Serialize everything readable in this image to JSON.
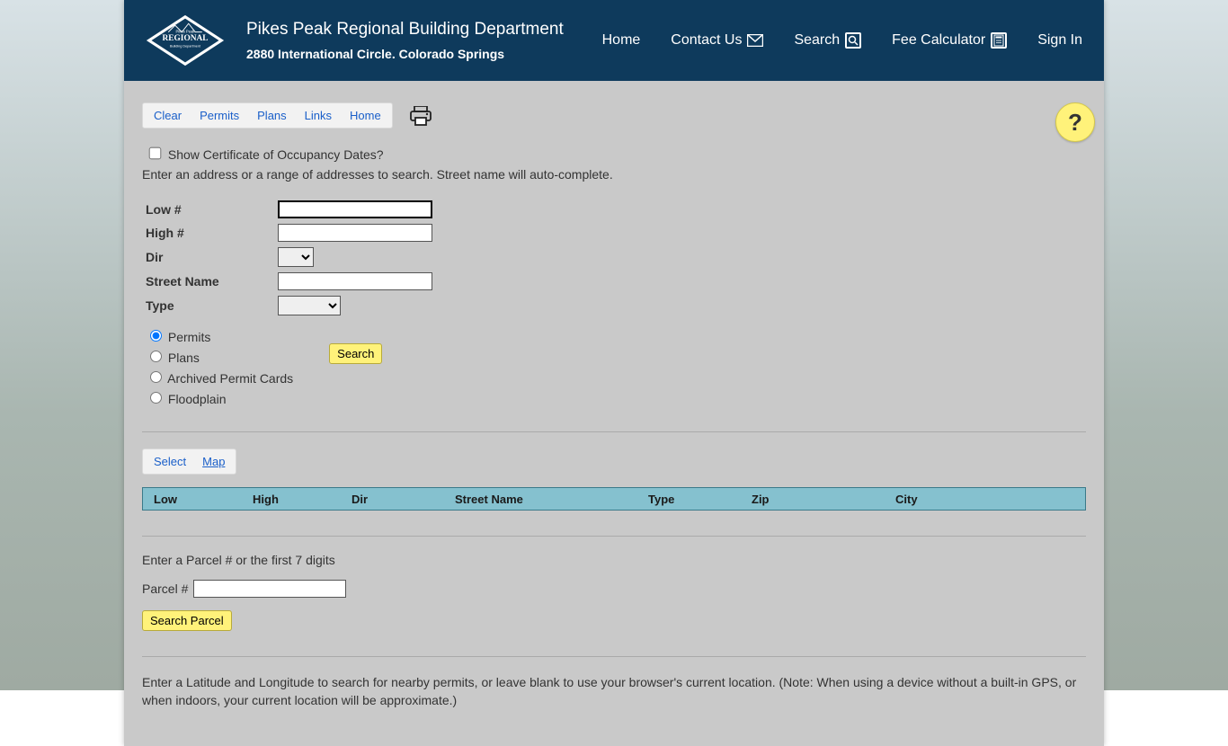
{
  "header": {
    "title": "Pikes Peak Regional Building Department",
    "subtitle": "2880 International Circle. Colorado Springs",
    "nav": {
      "home": "Home",
      "contact": "Contact Us",
      "search": "Search",
      "fee": "Fee Calculator",
      "signin": "Sign In"
    }
  },
  "toolbar": {
    "clear": "Clear",
    "permits": "Permits",
    "plans": "Plans",
    "links": "Links",
    "home": "Home"
  },
  "help_label": "?",
  "occupancy_checkbox_label": "Show Certificate of Occupancy Dates?",
  "address_intro": "Enter an address or a range of addresses to search. Street name will auto-complete.",
  "labels": {
    "low": "Low #",
    "high": "High #",
    "dir": "Dir",
    "street": "Street Name",
    "type": "Type"
  },
  "radios": {
    "permits": "Permits",
    "plans": "Plans",
    "archived": "Archived Permit Cards",
    "floodplain": "Floodplain"
  },
  "search_button": "Search",
  "mini_toolbar": {
    "select": "Select",
    "map": "Map"
  },
  "results_headers": {
    "low": "Low",
    "high": "High",
    "dir": "Dir",
    "street": "Street Name",
    "type": "Type",
    "zip": "Zip",
    "city": "City"
  },
  "parcel_intro": "Enter a Parcel # or the first 7 digits",
  "parcel_label": "Parcel #",
  "search_parcel_button": "Search Parcel",
  "latlng_text": "Enter a Latitude and Longitude to search for nearby permits, or leave blank to use your browser's current location. (Note: When using a device without a built-in GPS, or when indoors, your current location will be approximate.)"
}
